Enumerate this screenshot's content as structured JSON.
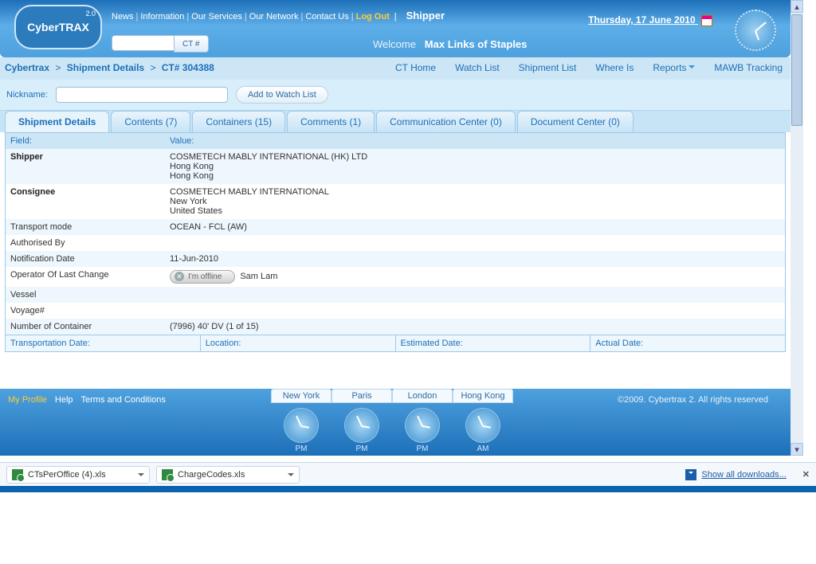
{
  "logo": {
    "brand": "CyberTRAX",
    "ver": "2.0"
  },
  "topnav": [
    "News",
    "Information",
    "Our Services",
    "Our Network",
    "Contact Us"
  ],
  "logout": "Log Out",
  "role": "Shipper",
  "search_btn": "CT #",
  "welcome_label": "Welcome",
  "welcome_user": "Max Links of Staples",
  "date": "Thursday, 17 June 2010",
  "breadcrumb": [
    "Cybertrax",
    "Shipment Details",
    "CT# 304388"
  ],
  "subnav": [
    "CT Home",
    "Watch List",
    "Shipment List",
    "Where Is",
    "Reports",
    "MAWB Tracking"
  ],
  "nickname_label": "Nickname:",
  "add_watch": "Add to Watch List",
  "tabs": [
    "Shipment Details",
    "Contents (7)",
    "Containers (15)",
    "Comments (1)",
    "Communication Center (0)",
    "Document Center (0)"
  ],
  "head_field": "Field:",
  "head_value": "Value:",
  "rows": [
    {
      "f": "Shipper",
      "v": "COSMETECH MABLY INTERNATIONAL (HK) LTD\nHong Kong\nHong Kong",
      "bold": true
    },
    {
      "f": "Consignee",
      "v": "COSMETECH MABLY INTERNATIONAL\nNew York\nUnited States",
      "bold": true
    },
    {
      "f": "Transport mode",
      "v": "OCEAN - FCL (AW)"
    },
    {
      "f": "Authorised By",
      "v": ""
    },
    {
      "f": "Notification Date",
      "v": "11-Jun-2010"
    },
    {
      "f": "Operator Of Last Change",
      "v": "",
      "status": "I'm offline",
      "person": "Sam Lam"
    },
    {
      "f": "Vessel",
      "v": ""
    },
    {
      "f": "Voyage#",
      "v": ""
    },
    {
      "f": "Number of Container",
      "v": "(7996) 40' DV (1 of 15)"
    }
  ],
  "quad": [
    "Transportation Date:",
    "Location:",
    "Estimated Date:",
    "Actual Date:"
  ],
  "footer_links": [
    "My Profile",
    "Help",
    "Terms and Conditions"
  ],
  "copyright": "©2009. Cybertrax 2. All rights reserved",
  "clocks": [
    {
      "city": "New York",
      "ampm": "PM"
    },
    {
      "city": "Paris",
      "ampm": "PM"
    },
    {
      "city": "London",
      "ampm": "PM"
    },
    {
      "city": "Hong Kong",
      "ampm": "AM"
    }
  ],
  "downloads": [
    "CTsPerOffice (4).xls",
    "ChargeCodes.xls"
  ],
  "show_all": "Show all downloads..."
}
